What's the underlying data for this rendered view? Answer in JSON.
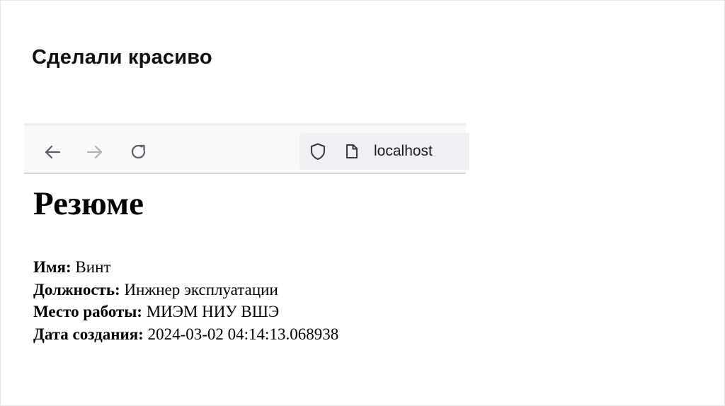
{
  "slide": {
    "title": "Сделали красиво"
  },
  "browser": {
    "address": "localhost",
    "icons": {
      "back": "back-arrow-icon",
      "forward": "forward-arrow-icon",
      "reload": "reload-icon",
      "shield": "shield-icon",
      "page": "page-icon"
    }
  },
  "page": {
    "heading": "Резюме",
    "fields": [
      {
        "label": "Имя:",
        "value": "Винт"
      },
      {
        "label": "Должность:",
        "value": "Инжнер эксплуатации"
      },
      {
        "label": "Место работы:",
        "value": "МИЭМ НИУ ВШЭ"
      },
      {
        "label": "Дата создания:",
        "value": "2024-03-02 04:14:13.068938"
      }
    ]
  },
  "colors": {
    "toolbar_bg": "#f9f9fb",
    "urlbar_bg": "#f0f0f4",
    "icon_active": "#5b5b66",
    "icon_disabled": "#b1b1b8",
    "text": "#000000"
  }
}
